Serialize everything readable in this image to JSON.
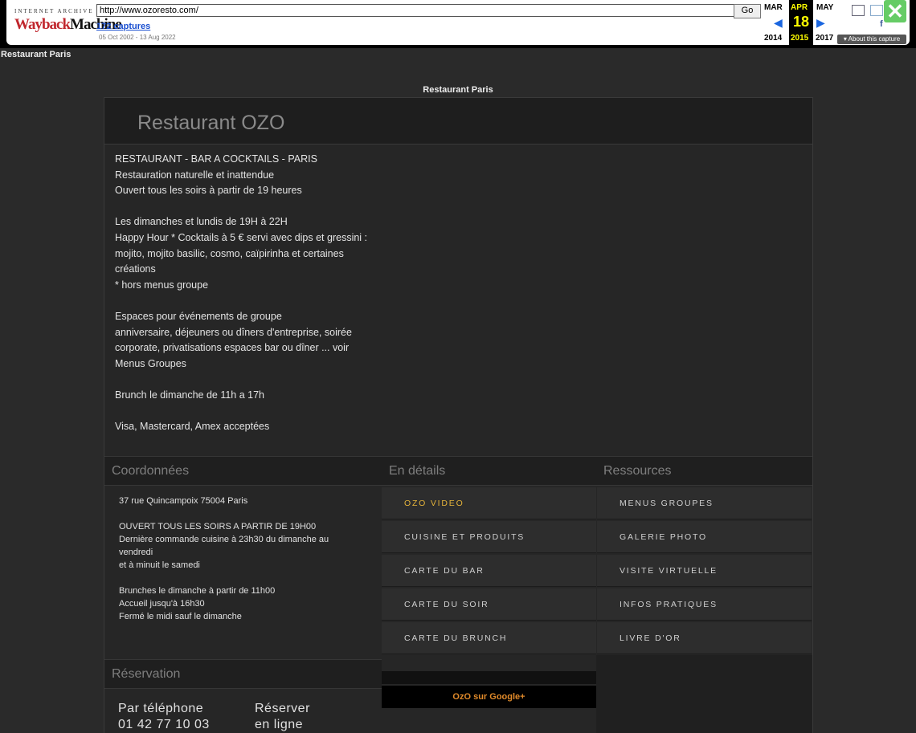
{
  "wayback": {
    "ia_label": "INTERNET ARCHIVE",
    "logo_part1": "Wayback",
    "logo_part2": "Machine",
    "url": "http://www.ozoresto.com/",
    "go_label": "Go",
    "captures": "172 captures",
    "date_range": "05 Oct 2002 - 13 Aug 2022",
    "prev_month": "MAR",
    "cur_month": "APR",
    "next_month": "MAY",
    "cur_day": "18",
    "prev_year": "2014",
    "cur_year": "2015",
    "next_year": "2017",
    "about": "▾ About this capture",
    "close": "✕"
  },
  "page": {
    "top_label": "Restaurant Paris",
    "mid_label": "Restaurant Paris",
    "title": "Restaurant OZO"
  },
  "intro": [
    "RESTAURANT - BAR A COCKTAILS - PARIS",
    "Restauration naturelle et inattendue",
    "Ouvert tous les soirs à partir de 19 heures",
    "",
    "Les dimanches et lundis de 19H à 22H",
    "Happy Hour * Cocktails à 5 € servi avec dips et gressini :",
    "mojito, mojito basilic, cosmo, caïpirinha et certaines",
    "créations",
    "* hors menus groupe",
    "",
    "Espaces pour événements de groupe",
    "anniversaire, déjeuners ou dîners d'entreprise, soirée",
    "corporate, privatisations espaces bar ou dîner ... voir",
    "Menus Groupes",
    "",
    "Brunch le dimanche de 11h a 17h",
    "",
    "Visa, Mastercard, Amex acceptées"
  ],
  "sections": {
    "coords": "Coordonnées",
    "details": "En détails",
    "resources": "Ressources",
    "reservation": "Réservation"
  },
  "coords": [
    "37 rue Quincampoix 75004 Paris",
    "",
    "OUVERT TOUS LES SOIRS A PARTIR DE 19H00",
    "Dernière commande cuisine à 23h30 du dimanche au",
    "vendredi",
    "et à minuit le samedi",
    "",
    "Brunches le dimanche à partir de 11h00",
    "Accueil jusqu'à 16h30",
    "Fermé le midi sauf le dimanche"
  ],
  "details_menu": [
    "OZO VIDEO",
    "CUISINE ET PRODUITS",
    "CARTE DU BAR",
    "CARTE DU SOIR",
    "CARTE DU BRUNCH"
  ],
  "resources_menu": [
    "MENUS GROUPES",
    "GALERIE PHOTO",
    "VISITE VIRTUELLE",
    "INFOS PRATIQUES",
    "LIVRE D'OR"
  ],
  "reservation": {
    "phone_label": "Par téléphone",
    "phone": "01 42 77 10 03",
    "online_label": "Réserver",
    "online_label2": "en ligne"
  },
  "google_plus": "OzO sur Google+",
  "colors": {
    "background": "#2a2a2a",
    "active_link": "#e3b23a",
    "google_link": "#e08a2a",
    "wayback_current": "#ffff00"
  }
}
